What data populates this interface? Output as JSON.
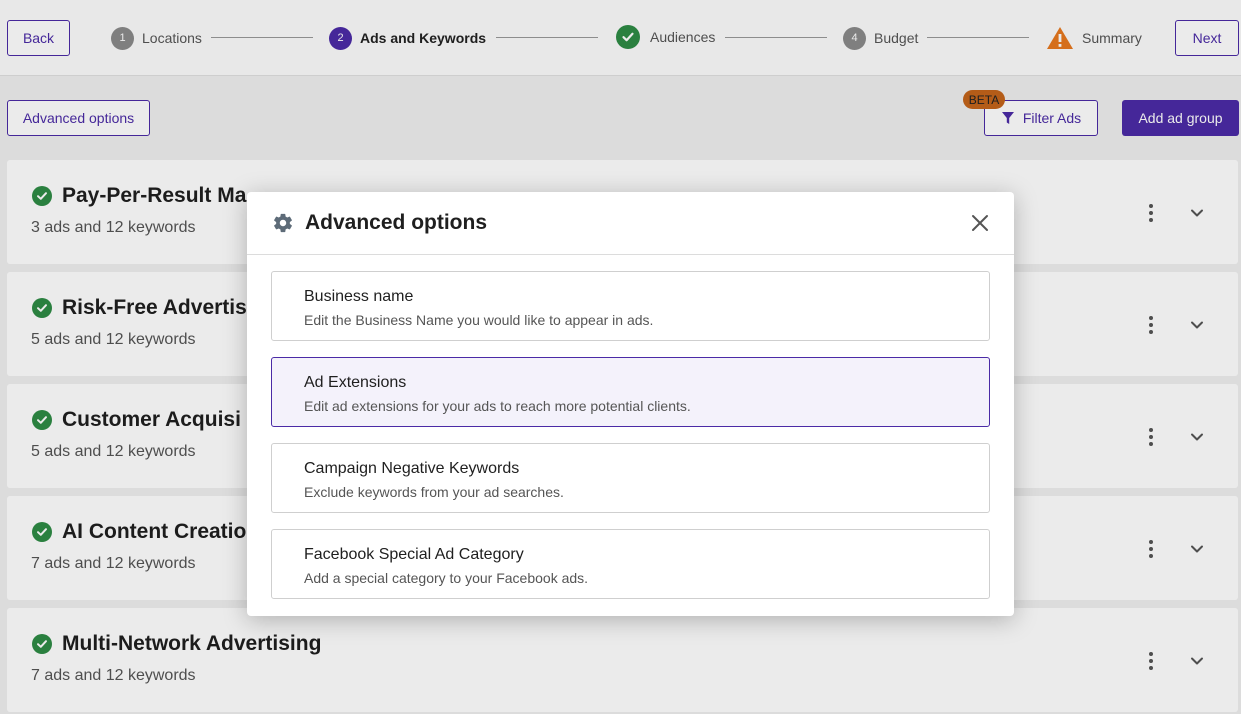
{
  "topbar": {
    "back_label": "Back",
    "next_label": "Next",
    "steps": [
      {
        "number": "1",
        "label": "Locations",
        "state": "pending"
      },
      {
        "number": "2",
        "label": "Ads and Keywords",
        "state": "active"
      },
      {
        "number": "",
        "label": "Audiences",
        "state": "complete"
      },
      {
        "number": "4",
        "label": "Budget",
        "state": "pending"
      },
      {
        "number": "",
        "label": "Summary",
        "state": "warning"
      }
    ]
  },
  "toolbar": {
    "advanced_label": "Advanced options",
    "beta_label": "BETA",
    "filter_label": "Filter Ads",
    "add_group_label": "Add ad group"
  },
  "ad_groups": [
    {
      "name": "Pay-Per-Result Ma",
      "summary": "3 ads and 12 keywords"
    },
    {
      "name": "Risk-Free Advertis",
      "summary": "5 ads and 12 keywords"
    },
    {
      "name": "Customer Acquisi",
      "summary": "5 ads and 12 keywords"
    },
    {
      "name": "AI Content Creatio",
      "summary": "7 ads and 12 keywords"
    },
    {
      "name": "Multi-Network Advertising",
      "summary": "7 ads and 12 keywords"
    }
  ],
  "modal": {
    "title": "Advanced options",
    "options": [
      {
        "title": "Business name",
        "description": "Edit the Business Name you would like to appear in ads.",
        "selected": false
      },
      {
        "title": "Ad Extensions",
        "description": "Edit ad extensions for your ads to reach more potential clients.",
        "selected": true
      },
      {
        "title": "Campaign Negative Keywords",
        "description": "Exclude keywords from your ad searches.",
        "selected": false
      },
      {
        "title": "Facebook Special Ad Category",
        "description": "Add a special category to your Facebook ads.",
        "selected": false
      }
    ]
  },
  "colors": {
    "brand": "#4b2ba6",
    "success": "#2e8b45",
    "warning": "#e8791f",
    "beta_badge": "#c4641b"
  },
  "icons": [
    "check-circle-icon",
    "warning-icon",
    "filter-icon",
    "kebab-menu-icon",
    "chevron-down-icon",
    "gear-icon",
    "close-icon"
  ]
}
